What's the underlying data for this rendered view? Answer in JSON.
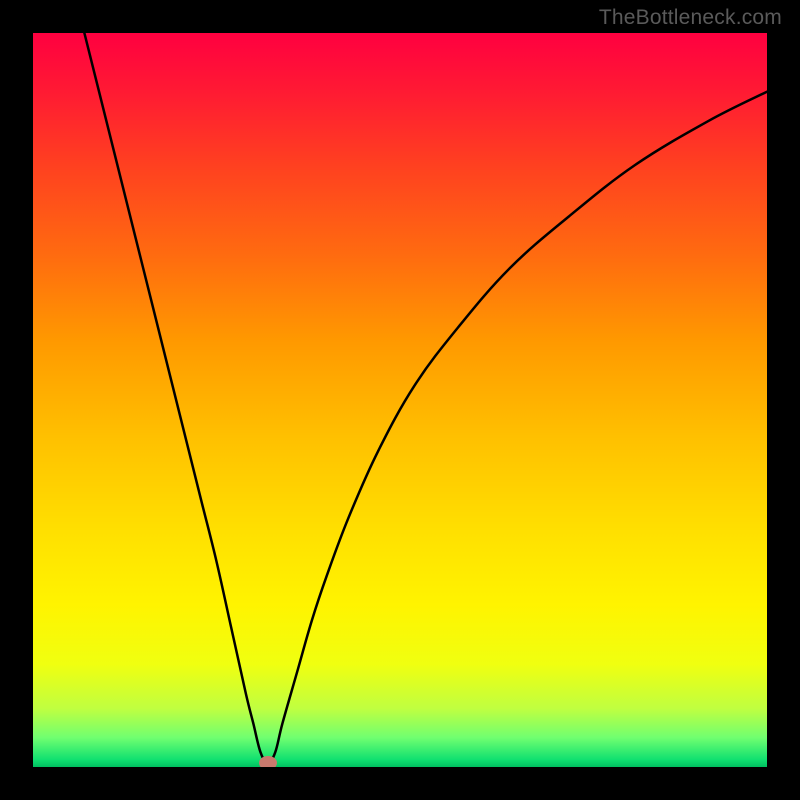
{
  "watermark": "TheBottleneck.com",
  "chart_data": {
    "type": "line",
    "title": "",
    "xlabel": "",
    "ylabel": "",
    "xlim": [
      0,
      100
    ],
    "ylim": [
      0,
      100
    ],
    "grid": false,
    "legend": false,
    "background": "red-yellow-green vertical gradient",
    "series": [
      {
        "name": "bottleneck-curve",
        "color": "#000000",
        "type": "line",
        "x": [
          7,
          9,
          11,
          13,
          15,
          17,
          19,
          21,
          23,
          25,
          27,
          29,
          30,
          31,
          32,
          33,
          34,
          36,
          38,
          40,
          43,
          47,
          52,
          58,
          65,
          73,
          82,
          92,
          100
        ],
        "y": [
          100,
          92,
          84,
          76,
          68,
          60,
          52,
          44,
          36,
          28,
          19,
          10,
          6,
          2,
          0.5,
          2,
          6,
          13,
          20,
          26,
          34,
          43,
          52,
          60,
          68,
          75,
          82,
          88,
          92
        ]
      }
    ],
    "marker": {
      "x": 32,
      "y": 0.6,
      "color": "#c97a6e"
    },
    "notes": "V-shaped curve reaching minimum near x≈32; background gradient maps vertical position to bottleneck severity (green=low at bottom, red=high at top). No axis ticks or labels are visible."
  }
}
